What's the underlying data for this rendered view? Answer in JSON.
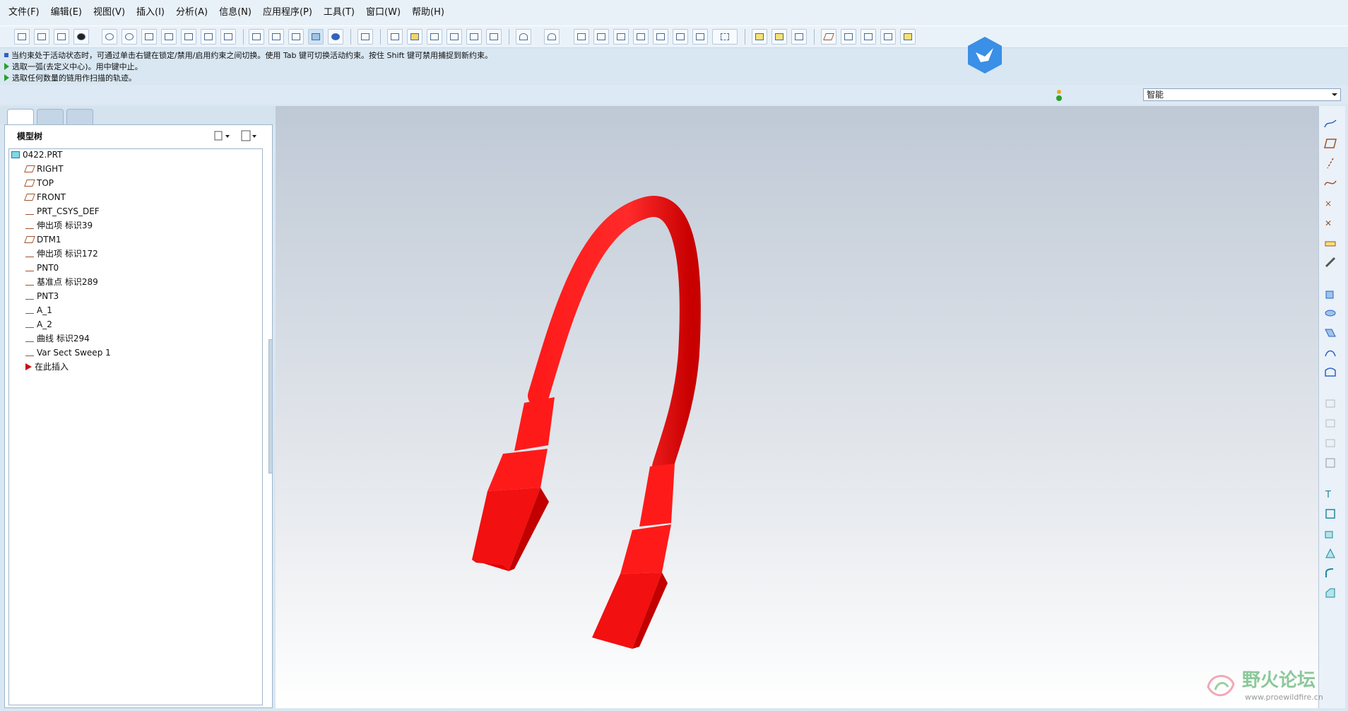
{
  "menu": [
    "文件(F)",
    "编辑(E)",
    "视图(V)",
    "插入(I)",
    "分析(A)",
    "信息(N)",
    "应用程序(P)",
    "工具(T)",
    "窗口(W)",
    "帮助(H)"
  ],
  "messages": [
    "当约束处于活动状态时，可通过单击右键在锁定/禁用/启用约束之间切换。使用 Tab 键可切换活动约束。按住 Shift 键可禁用捕捉到新约束。",
    "选取一弧(去定义中心)。用中键中止。",
    "选取任何数量的链用作扫描的轨迹。"
  ],
  "selection_filter": "智能",
  "model_tree": {
    "title": "模型树",
    "items": [
      {
        "label": "0422.PRT",
        "icon": "part-icon"
      },
      {
        "label": "RIGHT",
        "icon": "datum-plane-icon"
      },
      {
        "label": "TOP",
        "icon": "datum-plane-icon"
      },
      {
        "label": "FRONT",
        "icon": "datum-plane-icon"
      },
      {
        "label": "PRT_CSYS_DEF",
        "icon": "csys-icon"
      },
      {
        "label": "伸出项 标识39",
        "icon": "protrusion-icon"
      },
      {
        "label": "DTM1",
        "icon": "datum-plane-icon"
      },
      {
        "label": "伸出项 标识172",
        "icon": "protrusion-icon"
      },
      {
        "label": "PNT0",
        "icon": "datum-point-icon"
      },
      {
        "label": "基准点 标识289",
        "icon": "datum-point-icon"
      },
      {
        "label": "PNT3",
        "icon": "datum-point-icon"
      },
      {
        "label": "A_1",
        "icon": "datum-axis-icon"
      },
      {
        "label": "A_2",
        "icon": "datum-axis-icon"
      },
      {
        "label": "曲线 标识294",
        "icon": "curve-icon"
      },
      {
        "label": "Var Sect Sweep 1",
        "icon": "sweep-icon"
      },
      {
        "label": "在此插入",
        "icon": "insert-here-icon"
      }
    ]
  },
  "watermark": {
    "title": "野火论坛",
    "url": "www.proewildfire.cn"
  },
  "colors": {
    "model": "#ff1a1a",
    "accent": "#2d62c8"
  }
}
